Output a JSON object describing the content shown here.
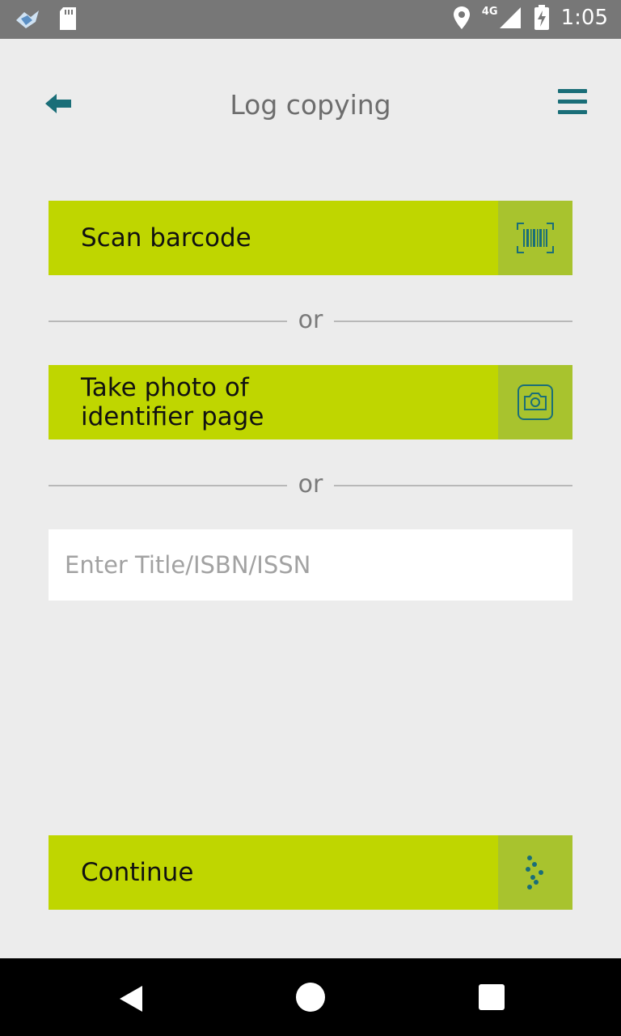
{
  "status_bar": {
    "time": "1:05",
    "network": "4G",
    "icons": [
      "app-notification-icon",
      "sd-card-icon",
      "location-icon",
      "signal-icon",
      "battery-charging-icon"
    ]
  },
  "header": {
    "title": "Log copying",
    "back_icon": "arrow-left-icon",
    "menu_icon": "hamburger-menu-icon"
  },
  "actions": {
    "scan_label": "Scan barcode",
    "scan_icon": "barcode-scan-icon",
    "photo_label": "Take photo of\nidentifier page",
    "photo_icon": "camera-icon",
    "continue_label": "Continue",
    "continue_icon": "dots-arrow-icon"
  },
  "dividers": {
    "first": "or",
    "second": "or"
  },
  "search": {
    "placeholder": "Enter Title/ISBN/ISSN",
    "value": ""
  },
  "nav_bar": {
    "icons": [
      "back-triangle-icon",
      "home-circle-icon",
      "recents-square-icon"
    ]
  },
  "colors": {
    "accent_green": "#bfd600",
    "icon_box_green": "#a8c32e",
    "teal": "#1a6e78",
    "background": "#ececec",
    "status_bar": "#777777"
  }
}
